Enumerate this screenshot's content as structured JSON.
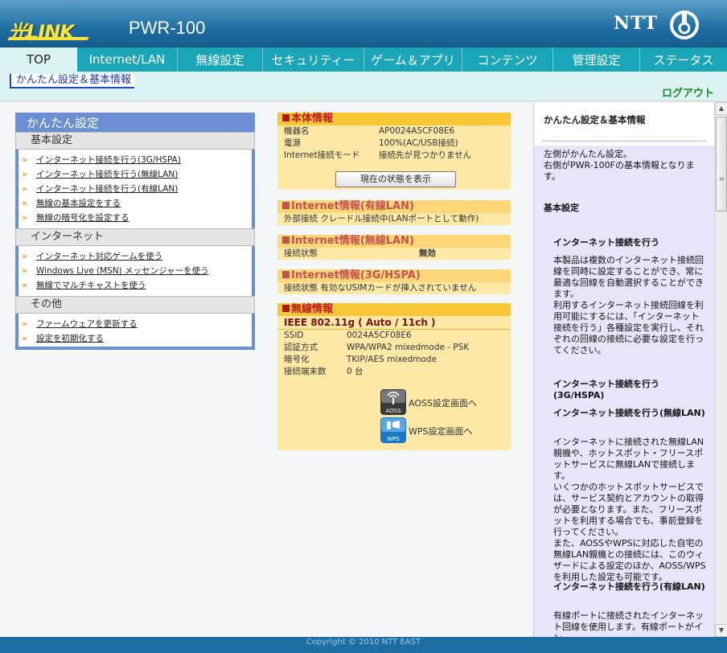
{
  "header": {
    "logo": "光LINK",
    "model": "PWR-100",
    "ntt": "NTT"
  },
  "nav": {
    "tabs": [
      {
        "label": "TOP",
        "active": true
      },
      {
        "label": "Internet/LAN"
      },
      {
        "label": "無線設定"
      },
      {
        "label": "セキュリティー"
      },
      {
        "label": "ゲーム＆アプリ"
      },
      {
        "label": "コンテンツ"
      },
      {
        "label": "管理設定"
      },
      {
        "label": "ステータス"
      }
    ],
    "breadcrumb": "かんたん設定＆基本情報",
    "logout": "ログアウト"
  },
  "left": {
    "title": "かんたん設定",
    "sections": [
      {
        "label": "基本設定",
        "links": [
          "インターネット接続を行う(3G/HSPA)",
          "インターネット接続を行う(無線LAN)",
          "インターネット接続を行う(有線LAN)",
          "無線の基本設定をする",
          "無線の暗号化を設定する"
        ]
      },
      {
        "label": "インターネット",
        "links": [
          "インターネット対応ゲームを使う",
          "Windows Live (MSN) メッセンジャーを使う",
          "無線でマルチキャストを使う"
        ]
      },
      {
        "label": "その他",
        "links": [
          "ファームウェアを更新する",
          "設定を初期化する"
        ]
      }
    ]
  },
  "center": {
    "device": {
      "title": "本体情報",
      "rows": [
        {
          "k": "機器名",
          "v": "AP0024A5CF08E6"
        },
        {
          "k": "電源",
          "v": "100%(AC/USB接続)"
        },
        {
          "k": "Internet接続モード",
          "v": "接続先が見つかりません"
        }
      ],
      "button": "現在の状態を表示"
    },
    "wired": {
      "title": "Internet情報(有線LAN)",
      "row": "外部接続 クレードル接続中(LANポートとして動作)"
    },
    "wireless_net": {
      "title": "Internet情報(無線LAN)",
      "k": "接続状態",
      "v": "無効"
    },
    "hspa": {
      "title": "Internet情報(3G/HSPA)",
      "row": "接続状態 有効なUSIMカードが挿入されていません"
    },
    "wireless": {
      "title": "無線情報",
      "ieee": "IEEE 802.11g ( Auto / 11ch )",
      "rows": [
        {
          "k": "SSID",
          "v": "0024A5CF08E6"
        },
        {
          "k": "認証方式",
          "v": "WPA/WPA2 mixedmode - PSK"
        },
        {
          "k": "暗号化",
          "v": "TKIP/AES mixedmode"
        },
        {
          "k": "接続端末数",
          "v": "0 台"
        }
      ],
      "aoss_label": "AOSS設定画面へ",
      "aoss_icon_text": "AOSS",
      "wps_label": "WPS設定画面へ",
      "wps_icon_text": "WPS"
    }
  },
  "help": {
    "title": "かんたん設定＆基本情報",
    "intro": "左側がかんたん設定。\n右側がPWR-100Fの基本情報となります。",
    "basic": "基本設定",
    "h1": "インターネット接続を行う",
    "p1": "本製品は複数のインターネット接続回線を同時に設定することができ、常に最適な回線を自動選択することができます。\n利用するインターネット接続回線を利用可能にするには、「インターネット接続を行う」各種設定を実行し、それぞれの回線の接続に必要な設定を行ってください。",
    "h2": "インターネット接続を行う(3G/HSPA)",
    "h3": "インターネット接続を行う(無線LAN)",
    "p3": "インターネットに接続された無線LAN親機や、ホットスポット・フリースポットサービスに無線LANで接続します。\nいくつかのホットスポットサービスでは、サービス契約とアカウントの取得が必要となります。また、フリースポットを利用する場合でも、事前登録を行ってください。\nまた、AOSSやWPSに対応した自宅の無線LAN親機との接続には、このウィザードによる設定のほか、AOSS/WPSを利用した設定も可能です。",
    "h4": "インターネット接続を行う(有線LAN)",
    "p4": "有線ポートに接続されたインターネット回線を使用します。有線ポートがイン"
  },
  "footer": "Copyright © 2010 NTT EAST",
  "colors": {
    "header": "#1f6ea3",
    "nav": "#1aa6b8",
    "accent_orange": "#f9c637",
    "panel_blue": "#6b8fd5"
  }
}
